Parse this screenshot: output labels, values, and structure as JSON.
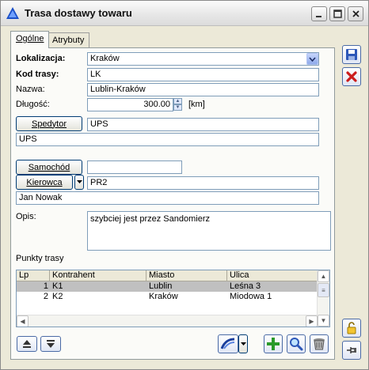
{
  "window": {
    "title": "Trasa dostawy towaru"
  },
  "tabs": [
    {
      "label": "Ogólne",
      "active": true
    },
    {
      "label": "Atrybuty",
      "active": false
    }
  ],
  "form": {
    "lokalizacja_label": "Lokalizacja:",
    "lokalizacja_value": "Kraków",
    "kod_label": "Kod trasy:",
    "kod_value": "LK",
    "nazwa_label": "Nazwa:",
    "nazwa_value": "Lublin-Kraków",
    "dlugosc_label": "Długość:",
    "dlugosc_value": "300.00",
    "dlugosc_unit": "[km]",
    "spedytor_button": "Spedytor",
    "spedytor_code": "UPS",
    "spedytor_name": "UPS",
    "samochod_button": "Samochód",
    "samochod_value": "",
    "kierowca_button": "Kierowca",
    "kierowca_code": "PR2",
    "kierowca_name": "Jan Nowak",
    "opis_label": "Opis:",
    "opis_value": "szybciej jest przez Sandomierz",
    "punkty_label": "Punkty trasy"
  },
  "grid": {
    "columns": [
      "Lp",
      "Kontrahent",
      "Miasto",
      "Ulica"
    ],
    "rows": [
      {
        "lp": "1",
        "kontrahent": "K1",
        "miasto": "Lublin",
        "ulica": "Leśna 3",
        "selected": true
      },
      {
        "lp": "2",
        "kontrahent": "K2",
        "miasto": "Kraków",
        "ulica": "Miodowa 1",
        "selected": false
      }
    ]
  },
  "icons": {
    "save": "floppy-disk",
    "cancel": "red-x",
    "lock": "padlock-open",
    "pin": "pushpin",
    "move_up": "arrow-up-bar",
    "move_down": "arrow-down-bar",
    "route": "route-map",
    "add": "green-plus",
    "search": "magnifier",
    "delete": "trash-can"
  },
  "colors": {
    "accent_blue": "#1f4fbf",
    "add_green": "#2a9a2a",
    "cancel_red": "#cc1c1c"
  }
}
